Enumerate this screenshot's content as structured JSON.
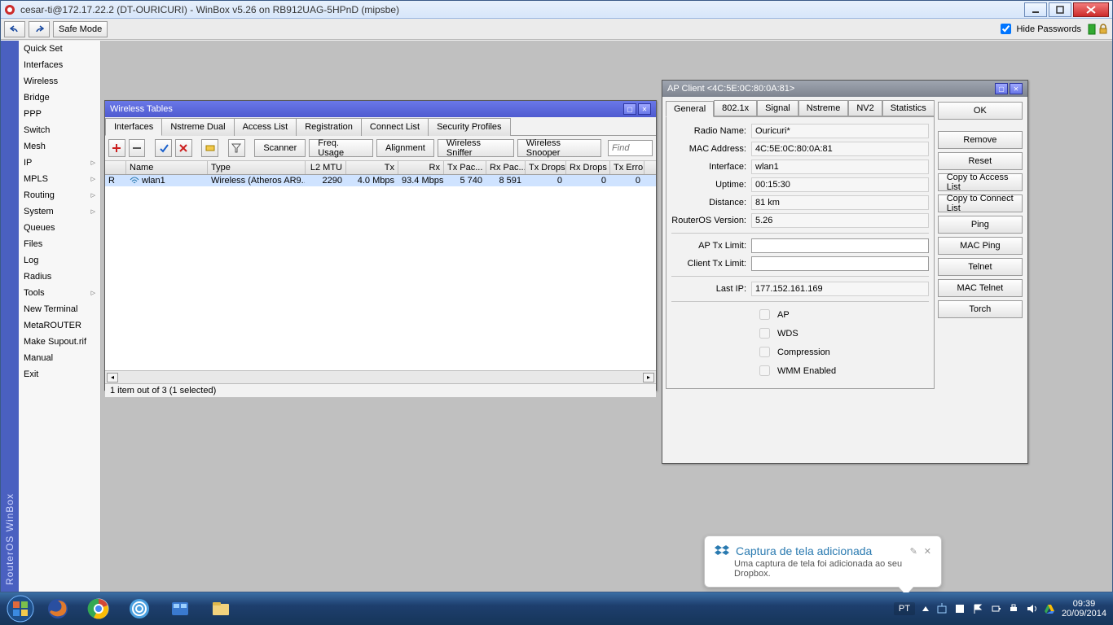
{
  "window": {
    "title": "cesar-ti@172.17.22.2 (DT-OURICURI) - WinBox v5.26 on RB912UAG-5HPnD (mipsbe)"
  },
  "toolbar": {
    "safe_mode": "Safe Mode",
    "hide_passwords": "Hide Passwords"
  },
  "rail": "RouterOS WinBox",
  "sidebar": [
    {
      "label": "Quick Set",
      "sub": false
    },
    {
      "label": "Interfaces",
      "sub": false
    },
    {
      "label": "Wireless",
      "sub": false
    },
    {
      "label": "Bridge",
      "sub": false
    },
    {
      "label": "PPP",
      "sub": false
    },
    {
      "label": "Switch",
      "sub": false
    },
    {
      "label": "Mesh",
      "sub": false
    },
    {
      "label": "IP",
      "sub": true
    },
    {
      "label": "MPLS",
      "sub": true
    },
    {
      "label": "Routing",
      "sub": true
    },
    {
      "label": "System",
      "sub": true
    },
    {
      "label": "Queues",
      "sub": false
    },
    {
      "label": "Files",
      "sub": false
    },
    {
      "label": "Log",
      "sub": false
    },
    {
      "label": "Radius",
      "sub": false
    },
    {
      "label": "Tools",
      "sub": true
    },
    {
      "label": "New Terminal",
      "sub": false
    },
    {
      "label": "MetaROUTER",
      "sub": false
    },
    {
      "label": "Make Supout.rif",
      "sub": false
    },
    {
      "label": "Manual",
      "sub": false
    },
    {
      "label": "Exit",
      "sub": false
    }
  ],
  "wt": {
    "title": "Wireless Tables",
    "tabs": [
      "Interfaces",
      "Nstreme Dual",
      "Access List",
      "Registration",
      "Connect List",
      "Security Profiles"
    ],
    "buttons": {
      "scanner": "Scanner",
      "freq": "Freq. Usage",
      "align": "Alignment",
      "sniffer": "Wireless Sniffer",
      "snooper": "Wireless Snooper"
    },
    "find": "Find",
    "columns": [
      "",
      "Name",
      "Type",
      "L2 MTU",
      "Tx",
      "Rx",
      "Tx Pac...",
      "Rx Pac...",
      "Tx Drops",
      "Rx Drops",
      "Tx Erro"
    ],
    "row": {
      "flag": "R",
      "name": "wlan1",
      "type": "Wireless (Atheros AR9...",
      "l2": "2290",
      "tx": "4.0 Mbps",
      "rx": "93.4 Mbps",
      "txp": "5 740",
      "rxp": "8 591",
      "txd": "0",
      "rxd": "0",
      "txe": "0"
    },
    "status": "1 item out of 3 (1 selected)"
  },
  "ap": {
    "title": "AP Client <4C:5E:0C:80:0A:81>",
    "tabs": [
      "General",
      "802.1x",
      "Signal",
      "Nstreme",
      "NV2",
      "Statistics"
    ],
    "side": [
      "OK",
      "Remove",
      "Reset",
      "Copy to Access List",
      "Copy to Connect List",
      "Ping",
      "MAC Ping",
      "Telnet",
      "MAC Telnet",
      "Torch"
    ],
    "fields": {
      "radio_name_label": "Radio Name:",
      "radio_name": "Ouricuri*",
      "mac_label": "MAC Address:",
      "mac": "4C:5E:0C:80:0A:81",
      "iface_label": "Interface:",
      "iface": "wlan1",
      "uptime_label": "Uptime:",
      "uptime": "00:15:30",
      "dist_label": "Distance:",
      "dist": "81 km",
      "ros_label": "RouterOS Version:",
      "ros": "5.26",
      "aptx_label": "AP Tx Limit:",
      "aptx": "",
      "cltx_label": "Client Tx Limit:",
      "cltx": "",
      "lastip_label": "Last IP:",
      "lastip": "177.152.161.169",
      "chk_ap": "AP",
      "chk_wds": "WDS",
      "chk_comp": "Compression",
      "chk_wmm": "WMM Enabled"
    }
  },
  "toast": {
    "title": "Captura de tela adicionada",
    "sub": "Uma captura de tela foi adicionada ao seu Dropbox."
  },
  "taskbar": {
    "lang": "PT",
    "time": "09:39",
    "date": "20/09/2014"
  }
}
